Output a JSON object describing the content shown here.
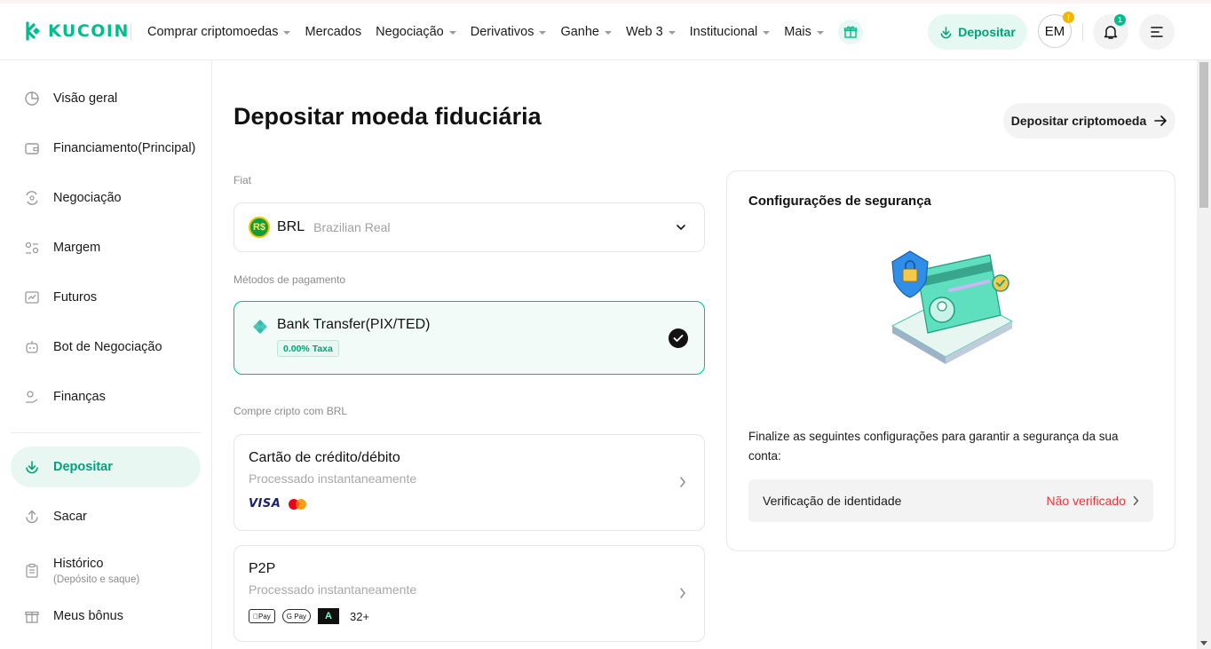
{
  "header": {
    "logo_text": "KUCOIN",
    "nav": [
      {
        "label": "Comprar criptomoedas",
        "caret": true
      },
      {
        "label": "Mercados",
        "caret": false
      },
      {
        "label": "Negociação",
        "caret": true
      },
      {
        "label": "Derivativos",
        "caret": true
      },
      {
        "label": "Ganhe",
        "caret": true
      },
      {
        "label": "Web 3",
        "caret": true
      },
      {
        "label": "Institucional",
        "caret": true
      },
      {
        "label": "Mais",
        "caret": true
      }
    ],
    "deposit_label": "Depositar",
    "avatar_initials": "EM",
    "avatar_badge": "!",
    "notification_count": "1",
    "accent": "#01bc8d"
  },
  "sidebar": {
    "items": [
      {
        "label": "Visão geral",
        "icon": "pie-chart-icon"
      },
      {
        "label": "Financiamento(Principal)",
        "icon": "wallet-icon"
      },
      {
        "label": "Negociação",
        "icon": "trade-icon"
      },
      {
        "label": "Margem",
        "icon": "margin-icon"
      },
      {
        "label": "Futuros",
        "icon": "futures-icon"
      },
      {
        "label": "Bot de Negociação",
        "icon": "bot-icon"
      },
      {
        "label": "Finanças",
        "icon": "finance-icon"
      },
      {
        "label": "Depositar",
        "icon": "deposit-icon",
        "active": true
      },
      {
        "label": "Sacar",
        "icon": "withdraw-icon"
      },
      {
        "label": "Histórico",
        "sub": "(Depósito e saque)",
        "icon": "history-icon"
      },
      {
        "label": "Meus bônus",
        "icon": "gift-icon"
      }
    ]
  },
  "main": {
    "title": "Depositar moeda fiduciária",
    "crypto_button": "Depositar criptomoeda",
    "fiat_label": "Fiat",
    "fiat": {
      "code": "BRL",
      "name": "Brazilian Real",
      "icon_text": "R$"
    },
    "payment_label": "Métodos de pagamento",
    "method": {
      "title": "Bank Transfer(PIX/TED)",
      "fee": "0.00% Taxa"
    },
    "buy_label": "Compre cripto com BRL",
    "buy_options": [
      {
        "title": "Cartão de crédito/débito",
        "sub": "Processado instantaneamente",
        "logos": [
          "VISA",
          "mastercard"
        ]
      },
      {
        "title": "P2P",
        "sub": "Processado instantaneamente",
        "logos": [
          "Pay",
          "G Pay",
          "A"
        ],
        "more": "32+"
      }
    ]
  },
  "security": {
    "title": "Configurações de segurança",
    "text": "Finalize as seguintes configurações para garantir a segurança da sua conta:",
    "row_label": "Verificação de identidade",
    "row_status": "Não verificado",
    "status_color": "#e5373a"
  }
}
